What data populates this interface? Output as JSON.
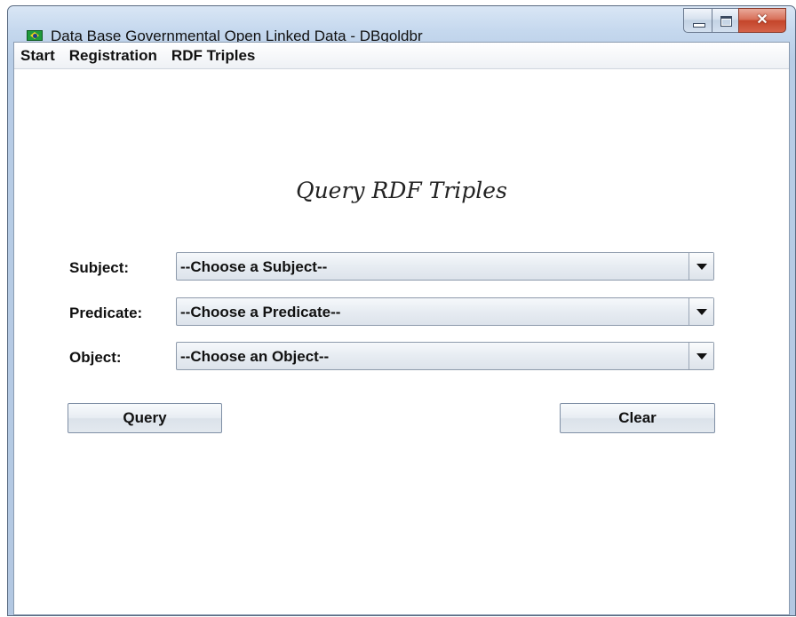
{
  "window": {
    "title": "Data Base Governmental Open Linked Data - DBgoldbr",
    "close_glyph": "✕"
  },
  "menu": {
    "items": [
      {
        "label": "Start"
      },
      {
        "label": "Registration"
      },
      {
        "label": "RDF Triples"
      }
    ]
  },
  "form": {
    "title": "Query RDF Triples",
    "subject": {
      "label": "Subject:",
      "value": "--Choose a Subject--"
    },
    "predicate": {
      "label": "Predicate:",
      "value": "--Choose a Predicate--"
    },
    "object": {
      "label": "Object:",
      "value": "--Choose an Object--"
    },
    "query_button": "Query",
    "clear_button": "Clear"
  },
  "icons": {
    "app": "brazil-flag-icon",
    "minimize": "minimize-icon",
    "maximize": "maximize-icon",
    "close": "close-icon",
    "dropdown": "chevron-down-icon"
  }
}
